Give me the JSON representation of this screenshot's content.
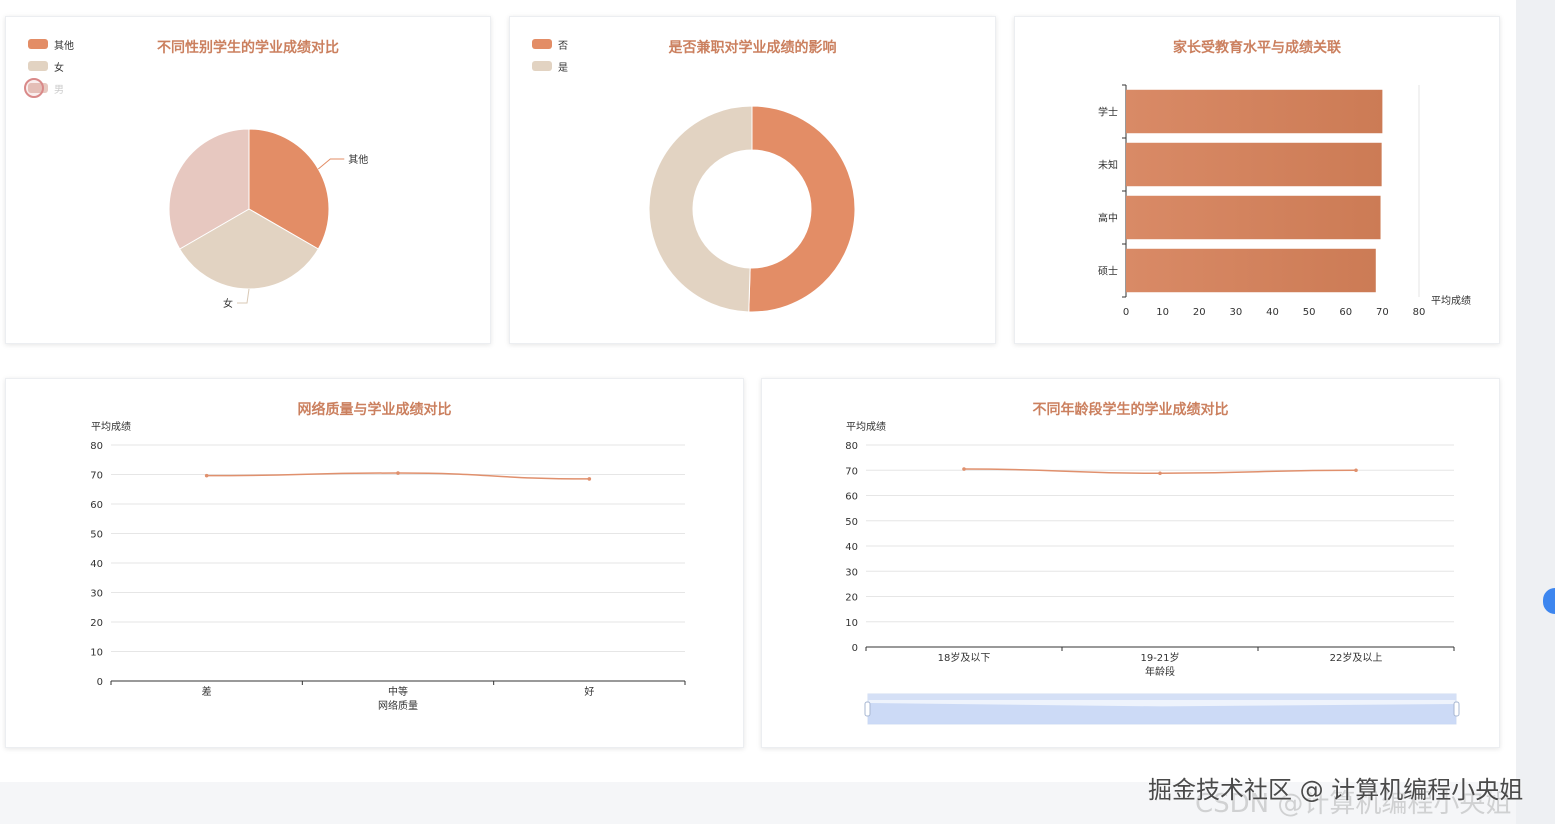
{
  "colors": {
    "accent": "#e38d66",
    "light": "#e2d3c2",
    "pink": "#e7c8c0",
    "bar": "#d0805b",
    "line": "#e0906d",
    "axis": "#333333",
    "grid": "#e6e6e6",
    "zoom": "#c8d7f5"
  },
  "watermark": {
    "primary": "掘金技术社区 @ 计算机编程小央姐",
    "secondary": "CSDN @计算机编程小央姐"
  },
  "pie_card": {
    "title": "不同性别学生的学业成绩对比",
    "legend": [
      "其他",
      "女",
      "男"
    ]
  },
  "donut_card": {
    "title": "是否兼职对学业成绩的影响",
    "legend": [
      "否",
      "是"
    ]
  },
  "bar_card": {
    "title": "家长受教育水平与成绩关联",
    "xlabel": "平均成绩",
    "categories": [
      "学士",
      "未知",
      "高中",
      "硕士"
    ],
    "ticks": [
      "0",
      "10",
      "20",
      "30",
      "40",
      "50",
      "60",
      "70",
      "80"
    ]
  },
  "net_card": {
    "title": "网络质量与学业成绩对比",
    "ylabel": "平均成绩",
    "xlabel": "网络质量",
    "yticks": [
      "80",
      "70",
      "60",
      "50",
      "40",
      "30",
      "20",
      "10",
      "0"
    ],
    "categories": [
      "差",
      "中等",
      "好"
    ]
  },
  "age_card": {
    "title": "不同年龄段学生的学业成绩对比",
    "ylabel": "平均成绩",
    "xlabel": "年龄段",
    "yticks": [
      "80",
      "70",
      "60",
      "50",
      "40",
      "30",
      "20",
      "10",
      "0"
    ],
    "categories": [
      "18岁及以下",
      "19-21岁",
      "22岁及以上"
    ]
  },
  "chart_data": [
    {
      "type": "pie",
      "title": "不同性别学生的学业成绩对比",
      "series": [
        {
          "name": "其他",
          "value": 33.3,
          "color": "#e38d66"
        },
        {
          "name": "女",
          "value": 33.3,
          "color": "#e2d3c2"
        },
        {
          "name": "男",
          "value": 33.3,
          "color": "#e7c8c0"
        }
      ],
      "legend": [
        "其他",
        "女",
        "男"
      ],
      "legend_position": "top-left"
    },
    {
      "type": "pie",
      "title": "是否兼职对学业成绩的影响",
      "donut": true,
      "series": [
        {
          "name": "否",
          "value": 50.5,
          "color": "#e38d66"
        },
        {
          "name": "是",
          "value": 49.5,
          "color": "#e2d3c2"
        }
      ],
      "legend": [
        "否",
        "是"
      ],
      "legend_position": "top-left"
    },
    {
      "type": "bar",
      "orientation": "horizontal",
      "title": "家长受教育水平与成绩关联",
      "categories": [
        "学士",
        "未知",
        "高中",
        "硕士"
      ],
      "values": [
        70,
        69.8,
        69.5,
        68.2
      ],
      "xlabel": "平均成绩",
      "xlim": [
        0,
        80
      ]
    },
    {
      "type": "line",
      "title": "网络质量与学业成绩对比",
      "categories": [
        "差",
        "中等",
        "好"
      ],
      "values": [
        69.6,
        70.5,
        68.5
      ],
      "xlabel": "网络质量",
      "ylabel": "平均成绩",
      "ylim": [
        0,
        80
      ],
      "grid": true
    },
    {
      "type": "line",
      "title": "不同年龄段学生的学业成绩对比",
      "categories": [
        "18岁及以下",
        "19-21岁",
        "22岁及以上"
      ],
      "values": [
        70.5,
        68.8,
        70.0
      ],
      "xlabel": "年龄段",
      "ylabel": "平均成绩",
      "ylim": [
        0,
        80
      ],
      "grid": true,
      "datazoom": true
    }
  ]
}
